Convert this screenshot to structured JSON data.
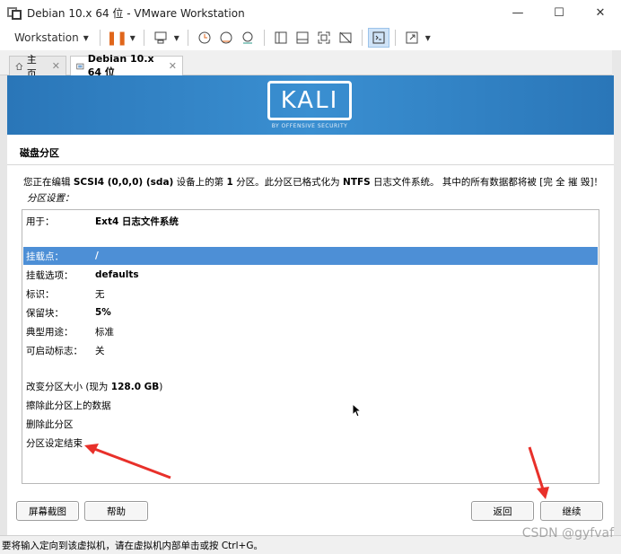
{
  "window": {
    "title": "Debian 10.x 64 位 - VMware Workstation",
    "minimize": "—",
    "maximize": "☐",
    "close": "✕"
  },
  "toolbar": {
    "workstation_label": "Workstation",
    "dropdown_glyph": "▾",
    "icons": [
      "pause-icon",
      "send-keys-icon",
      "snapshot-icon",
      "revert-snapshot-icon",
      "snapshot-manager-icon",
      "sidebar-icon",
      "thumbnail-icon",
      "fullscreen-icon",
      "unity-icon",
      "console-icon",
      "stretch-icon"
    ]
  },
  "tabs": [
    {
      "label": "主页",
      "icon": "home-icon",
      "close": "✕"
    },
    {
      "label": "Debian 10.x 64 位",
      "icon": "vm-icon",
      "close": "✕"
    }
  ],
  "installer": {
    "logo_text": "KALI",
    "logo_sub": "BY OFFENSIVE SECURITY",
    "heading": "磁盘分区",
    "desc_1": "您正在编辑 ",
    "desc_dev": "SCSI4 (0,0,0) (sda)",
    "desc_2": " 设备上的第 ",
    "desc_num": "1",
    "desc_3": " 分区。此分区已格式化为 ",
    "desc_fs": "NTFS",
    "desc_4": " 日志文件系统。 其中的所有数据都将被 [完 全 摧 毁]！",
    "subheading": "分区设置：",
    "settings": [
      {
        "key": "用于：",
        "value": "Ext4 日志文件系统",
        "bold": true,
        "selected": false
      },
      {
        "key": "挂载点：",
        "value": "/",
        "bold": true,
        "selected": true
      },
      {
        "key": "挂载选项：",
        "value": "defaults",
        "bold": true,
        "selected": false
      },
      {
        "key": "标识：",
        "value": "无",
        "bold": false,
        "selected": false
      },
      {
        "key": "保留块：",
        "value": "5%",
        "bold": true,
        "selected": false
      },
      {
        "key": "典型用途：",
        "value": "标准",
        "bold": false,
        "selected": false
      },
      {
        "key": "可启动标志：",
        "value": "关",
        "bold": false,
        "selected": false
      }
    ],
    "resize_label_a": "改变分区大小 (现为 ",
    "resize_size": "128.0 GB",
    "resize_label_b": ")",
    "erase_label": "擦除此分区上的数据",
    "delete_label": "删除此分区",
    "done_label": "分区设定结束",
    "screenshot_button": "屏幕截图",
    "help_button": "帮助",
    "back_button": "返回",
    "continue_button": "继续"
  },
  "statusbar": {
    "text": "要将输入定向到该虚拟机，请在虚拟机内部单击或按 Ctrl+G。",
    "watermark": "CSDN @gyfvaf"
  },
  "colors": {
    "banner": "#3a8fd1",
    "selection": "#4d8fd6",
    "arrow": "#e8302a",
    "pause": "#e0661b"
  }
}
